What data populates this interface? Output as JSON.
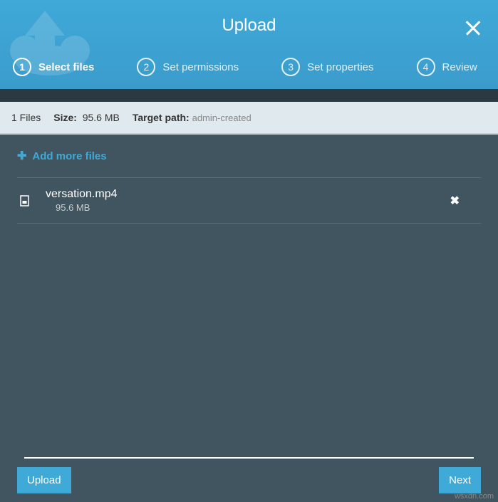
{
  "title": "Upload",
  "steps": [
    {
      "num": "1",
      "label": "Select files",
      "active": true
    },
    {
      "num": "2",
      "label": "Set permissions",
      "active": false
    },
    {
      "num": "3",
      "label": "Set properties",
      "active": false
    },
    {
      "num": "4",
      "label": "Review",
      "active": false
    }
  ],
  "info": {
    "files_count": "1 Files",
    "size_label": "Size:",
    "size_value": "95.6 MB",
    "target_label": "Target path:",
    "target_value": "admin-created"
  },
  "add_more_label": "Add more files",
  "files": [
    {
      "name": "versation.mp4",
      "size": "95.6 MB"
    }
  ],
  "buttons": {
    "upload": "Upload",
    "next": "Next"
  },
  "watermark": "wsxdn.com"
}
